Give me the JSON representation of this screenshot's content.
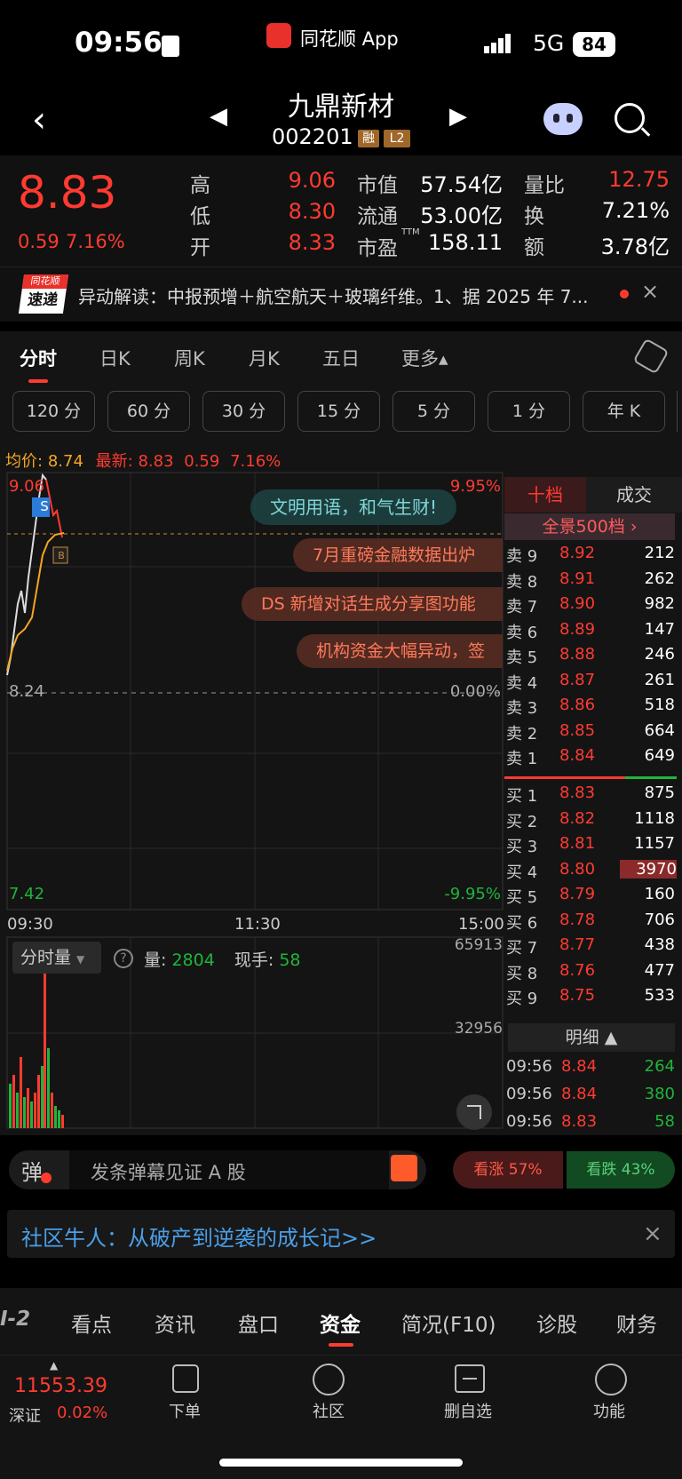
{
  "status": {
    "time": "09:56",
    "app": "同花顺 App",
    "network": "5G",
    "battery": "84"
  },
  "header": {
    "name": "九鼎新材",
    "code": "002201",
    "tag1": "融",
    "tag2": "L2"
  },
  "quote": {
    "price": "8.83",
    "change": "0.59",
    "pct": "7.16%",
    "high_label": "高",
    "high": "9.06",
    "low_label": "低",
    "low": "8.30",
    "open_label": "开",
    "open": "8.33",
    "mcap_label": "市值",
    "mcap": "57.54亿",
    "float_label": "流通",
    "float": "53.00亿",
    "pe_label": "市盈",
    "pe_sup": "TTM",
    "pe": "158.11",
    "vr_label": "量比",
    "vr": "12.75",
    "turn_label": "换",
    "turn": "7.21%",
    "amt_label": "额",
    "amt": "3.78亿"
  },
  "news": {
    "logo_top": "同花顺",
    "logo_bottom": "速递",
    "text": "异动解读：中报预增＋航空航天＋玻璃纤维。1、据 2025 年 7..."
  },
  "tabs": [
    "分时",
    "日K",
    "周K",
    "月K",
    "五日",
    "更多▴"
  ],
  "intervals": [
    "120 分",
    "60 分",
    "30 分",
    "15 分",
    "5 分",
    "1 分",
    "年 K"
  ],
  "chart_info": {
    "avg_label": "均价:",
    "avg": "8.74",
    "latest_label": "最新:",
    "latest": "8.83",
    "chg": "0.59",
    "pct": "7.16%"
  },
  "chart": {
    "top_price": "9.06",
    "top_pct": "9.95%",
    "mid_price": "8.24",
    "mid_pct": "0.00%",
    "bot_price": "7.42",
    "bot_pct": "-9.95%",
    "t0": "09:30",
    "t1": "11:30",
    "t2": "15:00",
    "marker_s": "S",
    "marker_b": "B"
  },
  "overlay_msgs": [
    "文明用语，和气生财!",
    "7月重磅金融数据出炉",
    "DS 新增对话生成分享图功能",
    "机构资金大幅异动，签"
  ],
  "vol": {
    "label": "分时量",
    "help": "?",
    "vol_label": "量:",
    "vol": "2804",
    "hand_label": "现手:",
    "hand": "58",
    "max": "65913",
    "mid": "32956"
  },
  "orderbook": {
    "tab_active": "十档",
    "tab_other": "成交",
    "panorama": "全景500档 ›",
    "asks": [
      {
        "l": "卖 9",
        "p": "8.92",
        "v": "212"
      },
      {
        "l": "卖 8",
        "p": "8.91",
        "v": "262"
      },
      {
        "l": "卖 7",
        "p": "8.90",
        "v": "982"
      },
      {
        "l": "卖 6",
        "p": "8.89",
        "v": "147"
      },
      {
        "l": "卖 5",
        "p": "8.88",
        "v": "246"
      },
      {
        "l": "卖 4",
        "p": "8.87",
        "v": "261"
      },
      {
        "l": "卖 3",
        "p": "8.86",
        "v": "518"
      },
      {
        "l": "卖 2",
        "p": "8.85",
        "v": "664"
      },
      {
        "l": "卖 1",
        "p": "8.84",
        "v": "649"
      }
    ],
    "bids": [
      {
        "l": "买 1",
        "p": "8.83",
        "v": "875"
      },
      {
        "l": "买 2",
        "p": "8.82",
        "v": "1118"
      },
      {
        "l": "买 3",
        "p": "8.81",
        "v": "1157"
      },
      {
        "l": "买 4",
        "p": "8.80",
        "v": "3970"
      },
      {
        "l": "买 5",
        "p": "8.79",
        "v": "160"
      },
      {
        "l": "买 6",
        "p": "8.78",
        "v": "706"
      },
      {
        "l": "买 7",
        "p": "8.77",
        "v": "438"
      },
      {
        "l": "买 8",
        "p": "8.76",
        "v": "477"
      },
      {
        "l": "买 9",
        "p": "8.75",
        "v": "533"
      }
    ],
    "detail_label": "明细 ▲",
    "details": [
      {
        "t": "09:56",
        "p": "8.84",
        "v": "264"
      },
      {
        "t": "09:56",
        "p": "8.84",
        "v": "380"
      },
      {
        "t": "09:56",
        "p": "8.83",
        "v": "58"
      }
    ]
  },
  "danmaku": {
    "icon": "弹",
    "placeholder": "发条弹幕见证 A 股",
    "up": "看涨 57%",
    "down": "看跌 43%"
  },
  "community": {
    "text": "社区牛人：从破产到逆袭的成长记>>",
    "close": "×"
  },
  "navbar": [
    "I-2",
    "看点",
    "资讯",
    "盘口",
    "资金",
    "简况(F10)",
    "诊股",
    "财务"
  ],
  "footer": {
    "index_value": "11553.39",
    "index_name": "深证",
    "index_pct": "0.02%",
    "order": "下单",
    "community": "社区",
    "remove": "删自选",
    "func": "功能"
  }
}
